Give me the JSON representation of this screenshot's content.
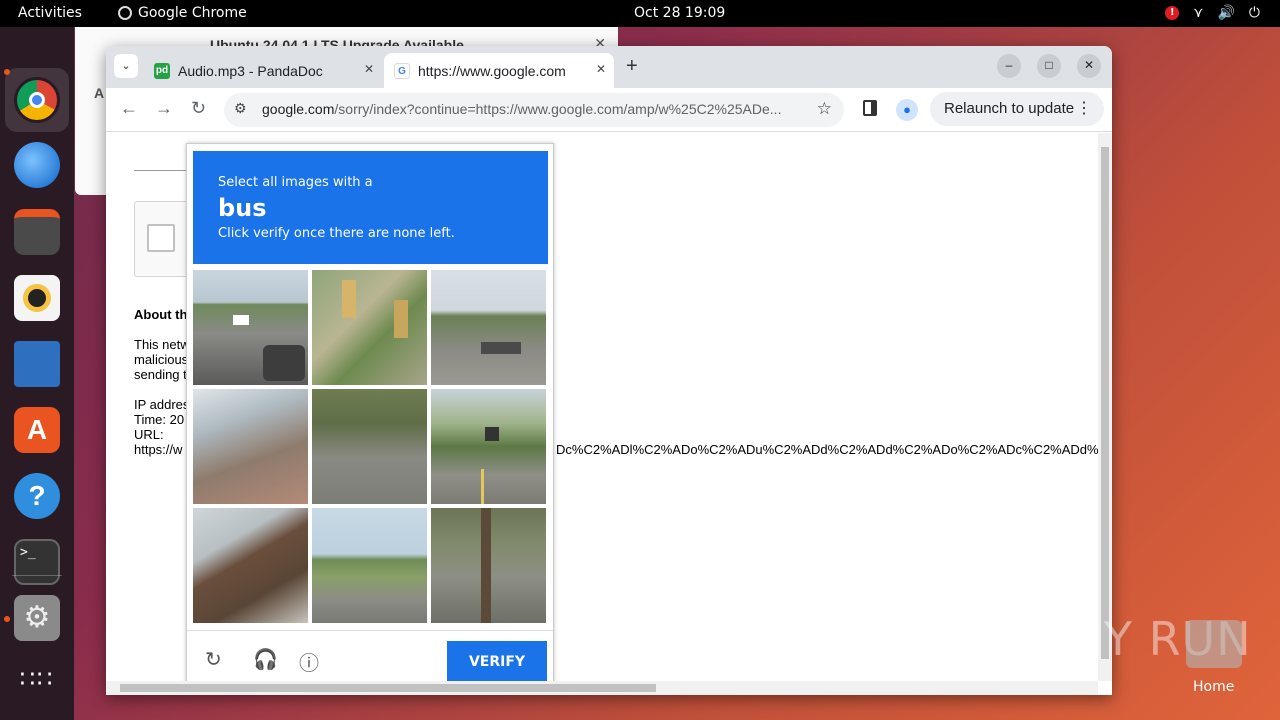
{
  "topbar": {
    "activities": "Activities",
    "app_name": "Google Chrome",
    "clock": "Oct 28  19:09",
    "alert_badge": "!"
  },
  "background_window": {
    "title": "Ubuntu 24.04.1 LTS Upgrade Available",
    "letter": "A"
  },
  "browser": {
    "tabs": [
      {
        "title": "Audio.mp3 - PandaDoc",
        "favicon": "pd"
      },
      {
        "title": "https://www.google.com",
        "favicon": "G"
      }
    ],
    "address_host": "google.com",
    "address_path": "/sorry/index?continue=https://www.google.com/amp/w%25C2%25ADe...",
    "relaunch_label": "Relaunch to update"
  },
  "page": {
    "about": "About th",
    "p1": "This netw",
    "p2": "malicious",
    "p3": "sending t",
    "ip": "IP addres",
    "time": "Time: 20",
    "url_label": "URL:",
    "url_start": "https://w",
    "url_tail": "Dc%C2%ADl%C2%ADo%C2%ADu%C2%ADd%C2%ADd%C2%ADo%C2%ADc%C2%ADd%"
  },
  "captcha": {
    "line1": "Select all images with a",
    "target": "bus",
    "line3": "Click verify once there are none left.",
    "verify_label": "VERIFY"
  },
  "watermark": "ANY RUN",
  "desktop": {
    "home_label": "Home"
  },
  "colors": {
    "captcha_blue": "#1a73e8",
    "ubuntu_orange": "#e95420"
  }
}
